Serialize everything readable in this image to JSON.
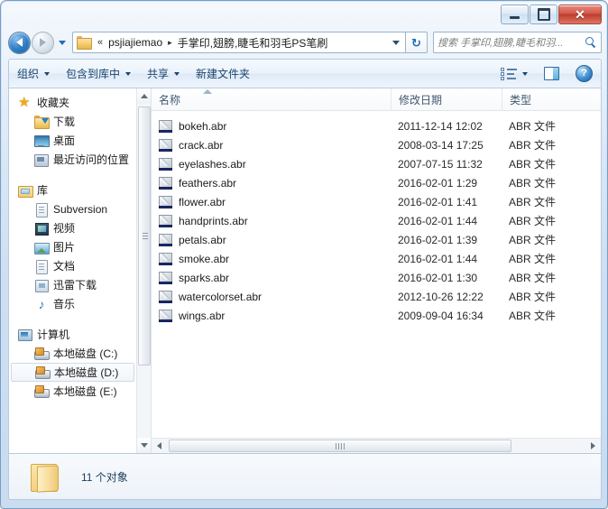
{
  "window": {
    "title": "",
    "buttons": {
      "minimize": "minimize",
      "maximize": "maximize",
      "close": "✕"
    }
  },
  "address": {
    "back_tooltip": "后退",
    "forward_tooltip": "前进",
    "overflow_chevron": "«",
    "crumbs": [
      {
        "label": "psjiajiemao",
        "separator": "▸"
      },
      {
        "label": "手掌印,翅膀,睫毛和羽毛PS笔刷",
        "separator": ""
      }
    ],
    "refresh_glyph": "↻"
  },
  "search": {
    "placeholder": "搜索 手掌印,翅膀,睫毛和羽..."
  },
  "toolbar": {
    "items": [
      {
        "label": "组织",
        "has_caret": true
      },
      {
        "label": "包含到库中",
        "has_caret": true
      },
      {
        "label": "共享",
        "has_caret": true
      },
      {
        "label": "新建文件夹",
        "has_caret": false
      }
    ],
    "view_icon": "view-list-icon",
    "preview_icon": "preview-pane-icon",
    "help_icon": "help-icon",
    "help_glyph": "?"
  },
  "sidebar": {
    "sections": [
      {
        "header": {
          "label": "收藏夹",
          "icon": "star-icon"
        },
        "items": [
          {
            "label": "下载",
            "icon": "downloads-icon"
          },
          {
            "label": "桌面",
            "icon": "desktop-icon"
          },
          {
            "label": "最近访问的位置",
            "icon": "recent-places-icon"
          }
        ]
      },
      {
        "header": {
          "label": "库",
          "icon": "library-icon"
        },
        "items": [
          {
            "label": "Subversion",
            "icon": "document-icon"
          },
          {
            "label": "视频",
            "icon": "video-icon"
          },
          {
            "label": "图片",
            "icon": "pictures-icon"
          },
          {
            "label": "文档",
            "icon": "documents-icon"
          },
          {
            "label": "迅雷下载",
            "icon": "thunder-download-icon"
          },
          {
            "label": "音乐",
            "icon": "music-icon"
          }
        ]
      },
      {
        "header": {
          "label": "计算机",
          "icon": "computer-icon"
        },
        "items": [
          {
            "label": "本地磁盘 (C:)",
            "icon": "drive-icon",
            "selected": false
          },
          {
            "label": "本地磁盘 (D:)",
            "icon": "drive-icon",
            "selected": true
          },
          {
            "label": "本地磁盘 (E:)",
            "icon": "drive-icon",
            "selected": false
          }
        ]
      }
    ]
  },
  "filelist": {
    "columns": [
      {
        "key": "name",
        "label": "名称"
      },
      {
        "key": "date",
        "label": "修改日期"
      },
      {
        "key": "type",
        "label": "类型"
      }
    ],
    "sort_column": "name",
    "sort_direction": "ascending",
    "rows": [
      {
        "name": "bokeh.abr",
        "date": "2011-12-14 12:02",
        "type": "ABR 文件",
        "icon": "abr-file-icon"
      },
      {
        "name": "crack.abr",
        "date": "2008-03-14 17:25",
        "type": "ABR 文件",
        "icon": "abr-file-icon"
      },
      {
        "name": "eyelashes.abr",
        "date": "2007-07-15 11:32",
        "type": "ABR 文件",
        "icon": "abr-file-icon"
      },
      {
        "name": "feathers.abr",
        "date": "2016-02-01 1:29",
        "type": "ABR 文件",
        "icon": "abr-file-icon"
      },
      {
        "name": "flower.abr",
        "date": "2016-02-01 1:41",
        "type": "ABR 文件",
        "icon": "abr-file-icon"
      },
      {
        "name": "handprints.abr",
        "date": "2016-02-01 1:44",
        "type": "ABR 文件",
        "icon": "abr-file-icon"
      },
      {
        "name": "petals.abr",
        "date": "2016-02-01 1:39",
        "type": "ABR 文件",
        "icon": "abr-file-icon"
      },
      {
        "name": "smoke.abr",
        "date": "2016-02-01 1:44",
        "type": "ABR 文件",
        "icon": "abr-file-icon"
      },
      {
        "name": "sparks.abr",
        "date": "2016-02-01 1:30",
        "type": "ABR 文件",
        "icon": "abr-file-icon"
      },
      {
        "name": "watercolorset.abr",
        "date": "2012-10-26 12:22",
        "type": "ABR 文件",
        "icon": "abr-file-icon"
      },
      {
        "name": "wings.abr",
        "date": "2009-09-04 16:34",
        "type": "ABR 文件",
        "icon": "abr-file-icon"
      }
    ]
  },
  "statusbar": {
    "item_count_text": "11 个对象",
    "folder_icon": "folder-icon"
  },
  "colors": {
    "frame": "#cfe0f2",
    "frame_border": "#7a9dc4",
    "close_button": "#bd3c2c",
    "toolbar_text": "#19436e",
    "column_header_text": "#40576f",
    "status_text": "#1a3b5c",
    "content_bg": "#ffffff"
  }
}
